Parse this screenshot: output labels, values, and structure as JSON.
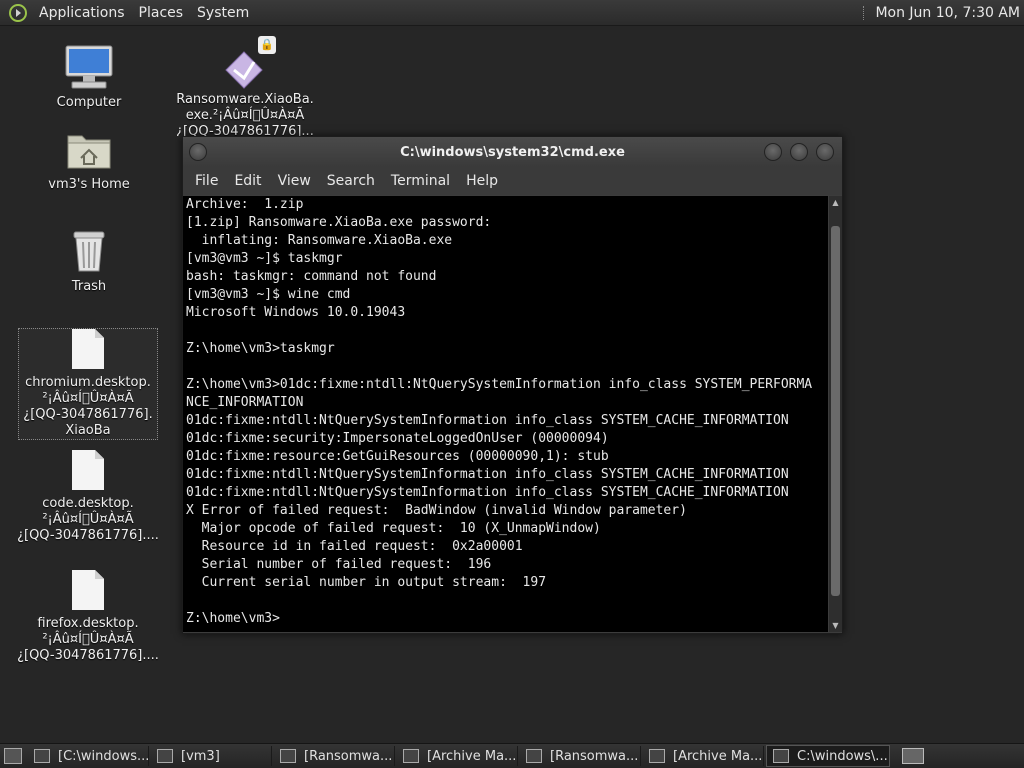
{
  "top_panel": {
    "menus": [
      "Applications",
      "Places",
      "System"
    ],
    "clock": "Mon Jun 10,  7:30 AM"
  },
  "desktop_icons": [
    {
      "label": "Computer"
    },
    {
      "label": "Ransomware.XiaoBa.\nexe.²¡Âû¤Í\u0000Û¤À¤Ã\n¿[QQ-3047861776]..."
    },
    {
      "label": "vm3's Home"
    },
    {
      "label": "Trash"
    },
    {
      "label": "chromium.desktop.\n²¡Âû¤Í\u0000Û¤À¤Ã\n¿[QQ-3047861776].\nXiaoBa"
    },
    {
      "label": "code.desktop.\n²¡Âû¤Í\u0000Û¤À¤Ã\n¿[QQ-3047861776]...."
    },
    {
      "label": "firefox.desktop.\n²¡Âû¤Í\u0000Û¤À¤Ã\n¿[QQ-3047861776]...."
    }
  ],
  "terminal": {
    "title": "C:\\windows\\system32\\cmd.exe",
    "menu": [
      "File",
      "Edit",
      "View",
      "Search",
      "Terminal",
      "Help"
    ],
    "lines": [
      "Archive:  1.zip",
      "[1.zip] Ransomware.XiaoBa.exe password:",
      "  inflating: Ransomware.XiaoBa.exe",
      "[vm3@vm3 ~]$ taskmgr",
      "bash: taskmgr: command not found",
      "[vm3@vm3 ~]$ wine cmd",
      "Microsoft Windows 10.0.19043",
      "",
      "Z:\\home\\vm3>taskmgr",
      "",
      "Z:\\home\\vm3>01dc:fixme:ntdll:NtQuerySystemInformation info_class SYSTEM_PERFORMA",
      "NCE_INFORMATION",
      "01dc:fixme:ntdll:NtQuerySystemInformation info_class SYSTEM_CACHE_INFORMATION",
      "01dc:fixme:security:ImpersonateLoggedOnUser (00000094)",
      "01dc:fixme:resource:GetGuiResources (00000090,1): stub",
      "01dc:fixme:ntdll:NtQuerySystemInformation info_class SYSTEM_CACHE_INFORMATION",
      "01dc:fixme:ntdll:NtQuerySystemInformation info_class SYSTEM_CACHE_INFORMATION",
      "X Error of failed request:  BadWindow (invalid Window parameter)",
      "  Major opcode of failed request:  10 (X_UnmapWindow)",
      "  Resource id in failed request:  0x2a00001",
      "  Serial number of failed request:  196",
      "  Current serial number in output stream:  197",
      "",
      "Z:\\home\\vm3>"
    ]
  },
  "taskbar": {
    "items": [
      {
        "label": "[C:\\windows..."
      },
      {
        "label": "[vm3]"
      },
      {
        "label": "[Ransomwa..."
      },
      {
        "label": "[Archive Ma..."
      },
      {
        "label": "[Ransomwa..."
      },
      {
        "label": "[Archive Ma..."
      },
      {
        "label": "C:\\windows\\..."
      }
    ]
  }
}
